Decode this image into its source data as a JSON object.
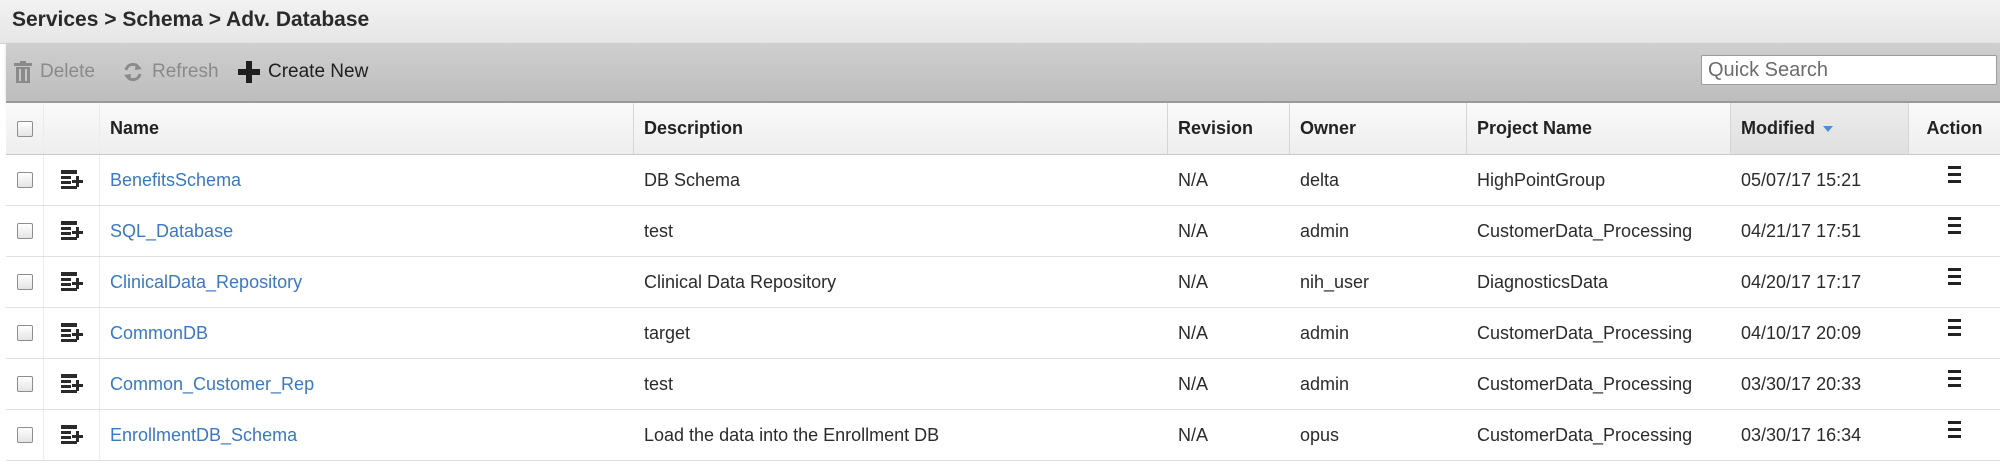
{
  "breadcrumb": {
    "items": [
      "Services",
      "Schema",
      "Adv. Database"
    ],
    "text": "Services > Schema > Adv. Database"
  },
  "toolbar": {
    "delete_label": "Delete",
    "refresh_label": "Refresh",
    "create_label": "Create New",
    "search_placeholder": "Quick Search"
  },
  "columns": {
    "name": "Name",
    "description": "Description",
    "revision": "Revision",
    "owner": "Owner",
    "project": "Project Name",
    "modified": "Modified",
    "action": "Action"
  },
  "sort": {
    "column": "modified",
    "direction": "descending"
  },
  "rows": [
    {
      "name": "BenefitsSchema",
      "description": "DB Schema",
      "revision": "N/A",
      "owner": "delta",
      "project": "HighPointGroup",
      "modified": "05/07/17 15:21"
    },
    {
      "name": "SQL_Database",
      "description": "test",
      "revision": "N/A",
      "owner": "admin",
      "project": "CustomerData_Processing",
      "modified": "04/21/17 17:51"
    },
    {
      "name": "ClinicalData_Repository",
      "description": "Clinical Data Repository",
      "revision": "N/A",
      "owner": "nih_user",
      "project": "DiagnosticsData",
      "modified": "04/20/17 17:17"
    },
    {
      "name": "CommonDB",
      "description": "target",
      "revision": "N/A",
      "owner": "admin",
      "project": "CustomerData_Processing",
      "modified": "04/10/17 20:09"
    },
    {
      "name": "Common_Customer_Rep",
      "description": "test",
      "revision": "N/A",
      "owner": "admin",
      "project": "CustomerData_Processing",
      "modified": "03/30/17 20:33"
    },
    {
      "name": "EnrollmentDB_Schema",
      "description": "Load the data into the Enrollment DB",
      "revision": "N/A",
      "owner": "opus",
      "project": "CustomerData_Processing",
      "modified": "03/30/17 16:34"
    }
  ],
  "colors": {
    "link": "#3a78c0",
    "sort_arrow": "#4a8fd6",
    "toolbar": "#c6c6c6"
  }
}
